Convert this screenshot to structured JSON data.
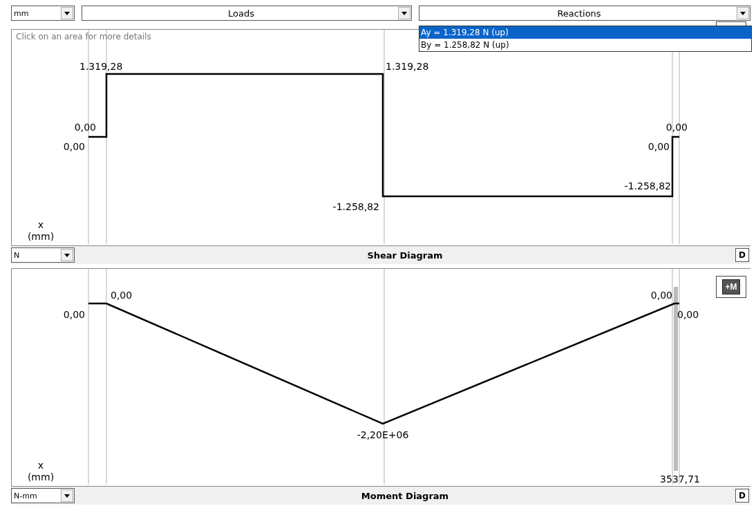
{
  "toolbar": {
    "unit_select": "mm",
    "loads_select": "Loads",
    "reactions_select": {
      "value": "Reactions",
      "options": [
        {
          "label": "Ay = 1.319,28 N (up)",
          "selected": true
        },
        {
          "label": "By = 1.258,82 N (up)",
          "selected": false
        }
      ]
    }
  },
  "shear_panel": {
    "hint": "Click on an area for more details",
    "labels": [
      "1.319,28",
      "1.319,28",
      "0,00",
      "0,00",
      "-1.258,82",
      "0,00",
      "0,00",
      "-1.258,82"
    ],
    "axis_label": "x",
    "axis_unit": "(mm)",
    "unit_select": "N",
    "title": "Shear Diagram",
    "button": "D"
  },
  "moment_panel": {
    "moment_button": "+M",
    "labels": [
      "0,00",
      "0,00",
      "-2,20E+06",
      "0,00",
      "0,00",
      "3537,71"
    ],
    "axis_label": "x",
    "axis_unit": "(mm)",
    "unit_select": "N-mm",
    "title": "Moment Diagram",
    "button": "D"
  }
}
